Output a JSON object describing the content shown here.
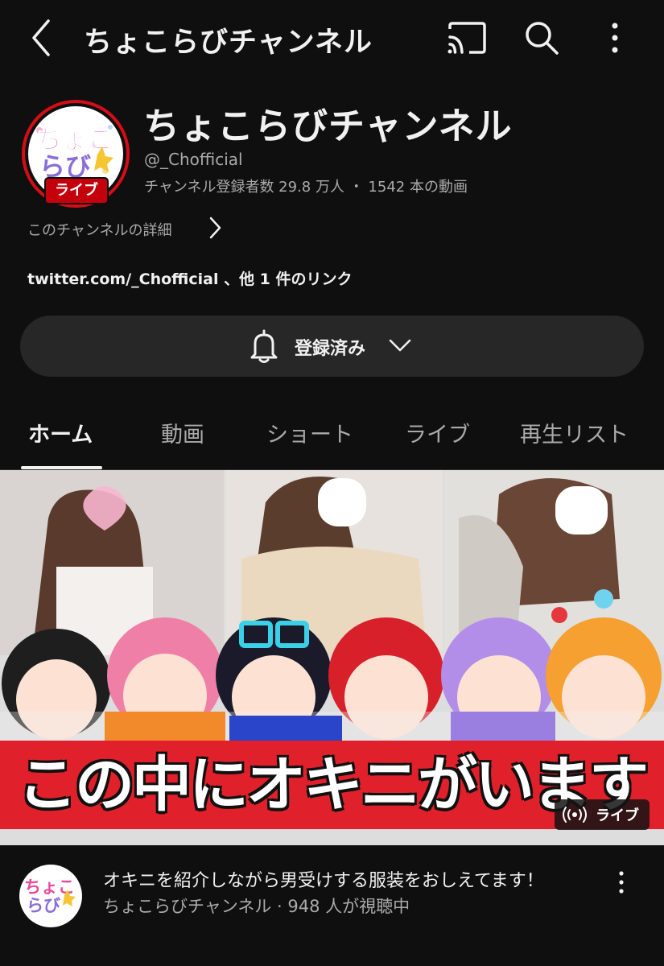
{
  "topbar": {
    "title": "ちょこらびチャンネル",
    "icons": [
      "back-icon",
      "cast-icon",
      "search-icon",
      "more-vert-icon"
    ]
  },
  "channel": {
    "name": "ちょこらびチャンネル",
    "handle": "@_Chofficial",
    "stats": "チャンネル登録者数 29.8 万人 ・ 1542 本の動画",
    "live_badge": "ライブ",
    "details_label": "このチャンネルの詳細",
    "link_text": "twitter.com/_Chofficial 、他 1 件のリンク",
    "avatar_text_line1": "ちょこ",
    "avatar_text_line2": "らび"
  },
  "subscribe": {
    "label": "登録済み"
  },
  "tabs": [
    {
      "label": "ホーム",
      "active": true
    },
    {
      "label": "動画",
      "active": false
    },
    {
      "label": "ショート",
      "active": false
    },
    {
      "label": "ライブ",
      "active": false
    },
    {
      "label": "再生リスト",
      "active": false
    }
  ],
  "featured": {
    "thumbnail_caption": "この中にオキニがいます",
    "live_chip": "ライブ",
    "title": "オキニを紹介しながら男受けする服装をおしえてます！",
    "subline": "ちょこらびチャンネル · 948 人が視聴中"
  },
  "colors": {
    "background": "#0f0f0f",
    "live_red": "#c4000d",
    "banner_red": "#e0202a",
    "secondary_text": "#aaaaaa"
  }
}
